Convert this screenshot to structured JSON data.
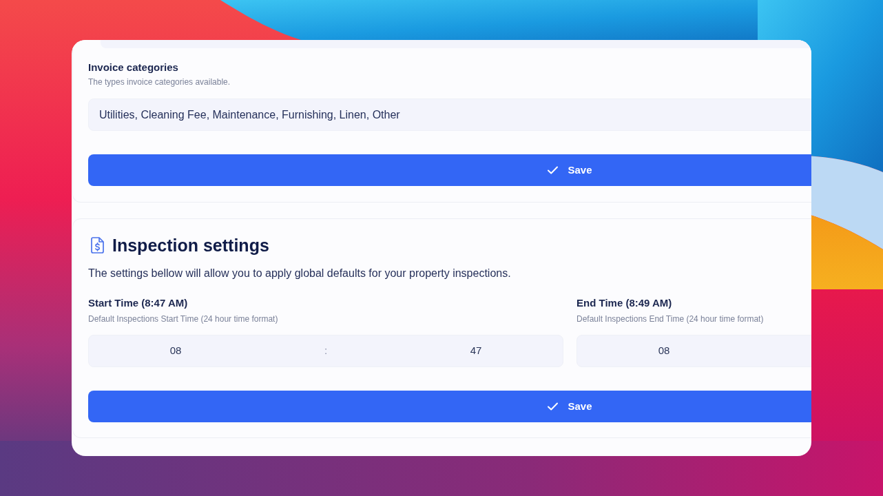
{
  "invoice_categories": {
    "label": "Invoice categories",
    "hint": "The types invoice categories available.",
    "value": "Utilities, Cleaning Fee, Maintenance, Furnishing, Linen, Other",
    "save_button": "Save"
  },
  "inspection_settings": {
    "title": "Inspection settings",
    "description": "The settings bellow will allow you to apply global defaults for your property inspections.",
    "fields": [
      {
        "label": "Start Time (8:47 AM)",
        "hint": "Default Inspections Start Time (24 hour time format)",
        "hours": "08",
        "separator": ":",
        "minutes": "47"
      },
      {
        "label": "End Time (8:49 AM)",
        "hint": "Default Inspections End Time (24 hour time format)",
        "hours": "08"
      }
    ],
    "save_button": "Save"
  }
}
